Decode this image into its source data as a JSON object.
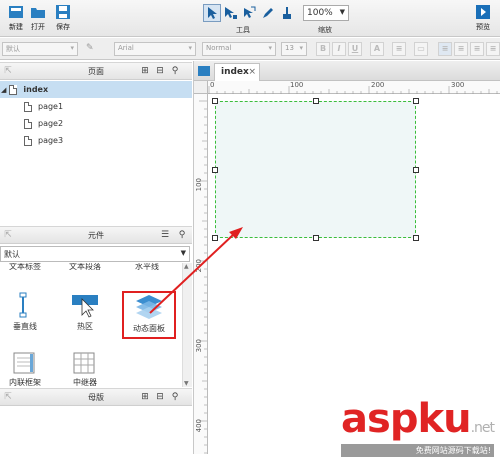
{
  "toolbar": {
    "new_label": "新建",
    "open_label": "打开",
    "save_label": "保存",
    "tools_label": "工具",
    "zoom_value": "100%",
    "zoom_label": "缩放",
    "preview_label": "预览"
  },
  "formatbar": {
    "style_value": "默认",
    "font_value": "Arial",
    "weight_value": "Normal",
    "size_value": "13"
  },
  "pages_panel": {
    "title": "页面",
    "root": "index",
    "pages": [
      "page1",
      "page2",
      "page3"
    ]
  },
  "widgets_panel": {
    "title": "元件",
    "library": "默认",
    "cutoff_row": [
      "文本标签",
      "文本段落",
      "水平线"
    ],
    "items": [
      "垂直线",
      "热区",
      "动态面板"
    ],
    "bottom_cutoff_row": [
      "内联框架",
      "中继器"
    ]
  },
  "masters_panel": {
    "title": "母版"
  },
  "canvas": {
    "tab_label": "index",
    "ruler_h": [
      "0",
      "100",
      "200",
      "300"
    ],
    "ruler_v": [
      "100",
      "200",
      "300",
      "400"
    ]
  },
  "watermark": {
    "text": "aspku",
    "suffix": ".net",
    "subtitle": "免费网站源码下载站!"
  },
  "colors": {
    "selection_green": "#3bbd3b",
    "panel_fill": "#eff7f7",
    "annotation_red": "#e02020",
    "tree_selected": "#c6def2"
  }
}
